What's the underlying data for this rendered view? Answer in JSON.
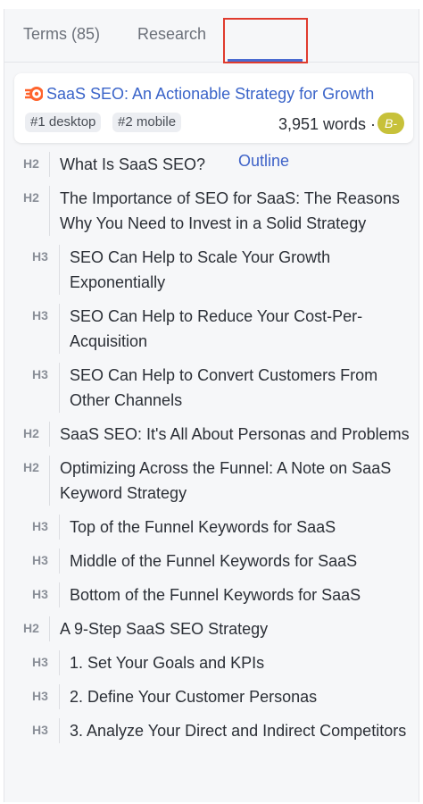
{
  "tabs": {
    "terms": "Terms (85)",
    "research": "Research",
    "outline": "Outline"
  },
  "card": {
    "title": "SaaS SEO: An Actionable Strategy for Growth",
    "rank_desktop": "#1 desktop",
    "rank_mobile": "#2 mobile",
    "word_count": "3,951 words ·",
    "grade": "B-",
    "icon": "semrush-icon"
  },
  "outline": [
    {
      "level": "H2",
      "text": "What Is SaaS SEO?"
    },
    {
      "level": "H2",
      "text": "The Importance of SEO for SaaS: The Reasons Why You Need to Invest in a Solid Strategy"
    },
    {
      "level": "H3",
      "text": "SEO Can Help to Scale Your Growth Exponentially"
    },
    {
      "level": "H3",
      "text": "SEO Can Help to Reduce Your Cost-Per-Acquisition"
    },
    {
      "level": "H3",
      "text": "SEO Can Help to Convert Customers From Other Channels"
    },
    {
      "level": "H2",
      "text": "SaaS SEO: It's All About Personas and Problems"
    },
    {
      "level": "H2",
      "text": "Optimizing Across the Funnel: A Note on SaaS Keyword Strategy"
    },
    {
      "level": "H3",
      "text": "Top of the Funnel Keywords for SaaS"
    },
    {
      "level": "H3",
      "text": "Middle of the Funnel Keywords for SaaS"
    },
    {
      "level": "H3",
      "text": "Bottom of the Funnel Keywords for SaaS"
    },
    {
      "level": "H2",
      "text": "A 9-Step SaaS SEO Strategy"
    },
    {
      "level": "H3",
      "text": "1. Set Your Goals and KPIs"
    },
    {
      "level": "H3",
      "text": "2. Define Your Customer Personas"
    },
    {
      "level": "H3",
      "text": "3. Analyze Your Direct and Indirect Competitors"
    }
  ],
  "colors": {
    "accent": "#3f63c8",
    "highlight_box": "#e03b2e",
    "grade_bg": "#c7c13a",
    "brand_icon": "#ff642d"
  }
}
